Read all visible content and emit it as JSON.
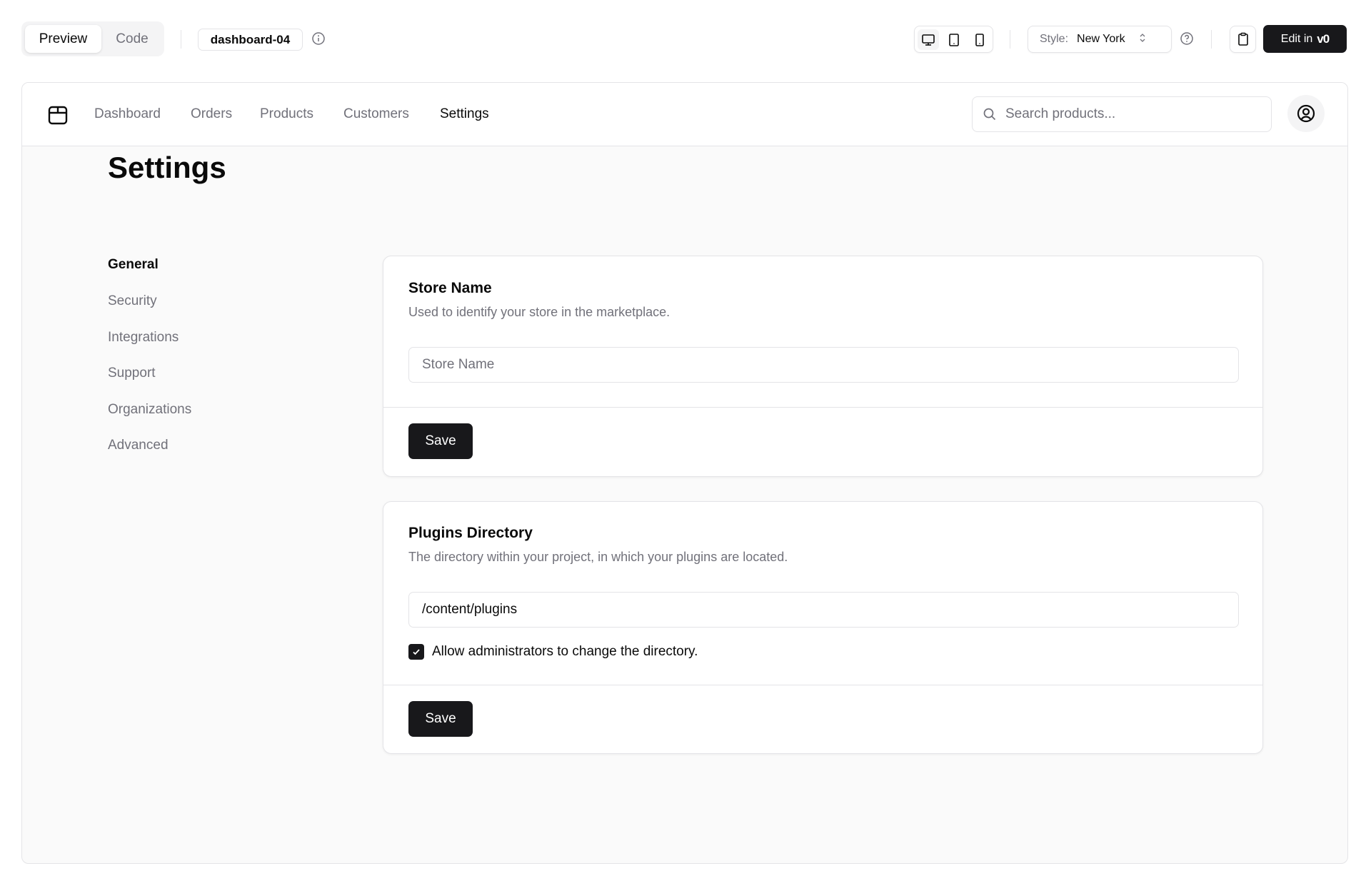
{
  "toolbar": {
    "preview_label": "Preview",
    "code_label": "Code",
    "block_name": "dashboard-04",
    "style_label": "Style:",
    "style_value": "New York",
    "edit_label": "Edit in",
    "edit_brand": "v0"
  },
  "nav": {
    "items": [
      "Dashboard",
      "Orders",
      "Products",
      "Customers",
      "Settings"
    ],
    "active": "Settings",
    "search_placeholder": "Search products..."
  },
  "page": {
    "title": "Settings",
    "sidebar": [
      "General",
      "Security",
      "Integrations",
      "Support",
      "Organizations",
      "Advanced"
    ],
    "sidebar_active": "General"
  },
  "store_card": {
    "title": "Store Name",
    "description": "Used to identify your store in the marketplace.",
    "input_placeholder": "Store Name",
    "input_value": "",
    "save_label": "Save"
  },
  "plugins_card": {
    "title": "Plugins Directory",
    "description": "The directory within your project, in which your plugins are located.",
    "input_value": "/content/plugins",
    "checkbox_label": "Allow administrators to change the directory.",
    "checkbox_checked": true,
    "save_label": "Save"
  }
}
